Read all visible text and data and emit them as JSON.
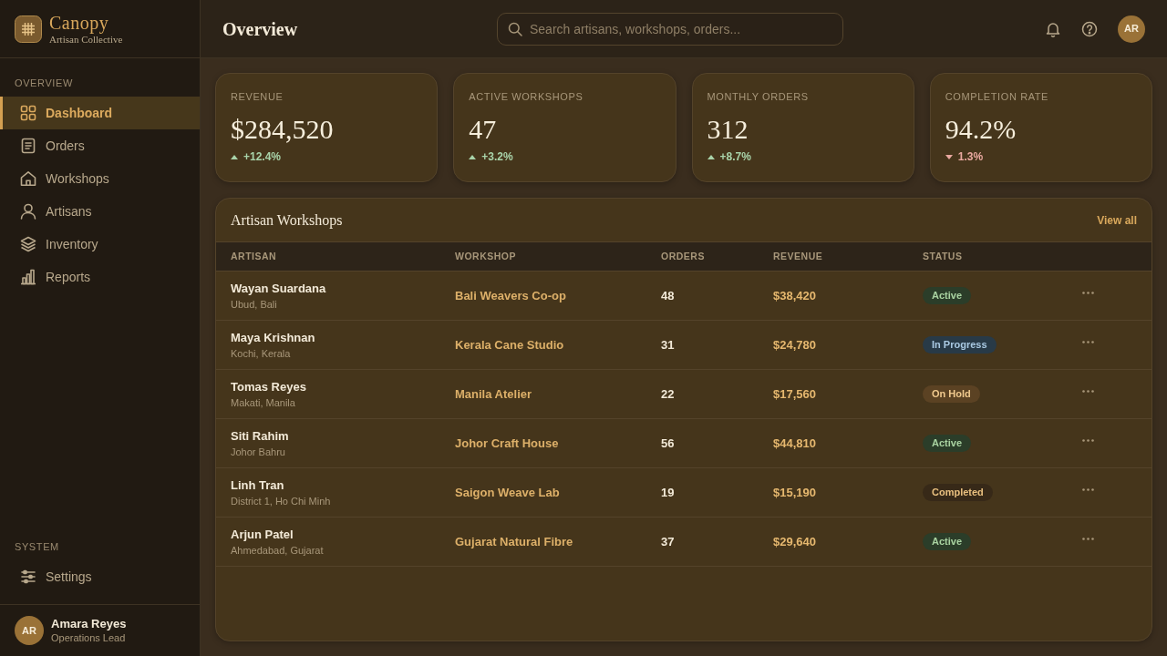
{
  "brand": {
    "name": "Canopy",
    "tagline": "Artisan Collective"
  },
  "sidebar": {
    "sections": [
      {
        "title": "OVERVIEW",
        "items": [
          {
            "label": "Dashboard",
            "selected": true
          },
          {
            "label": "Orders",
            "selected": false
          },
          {
            "label": "Workshops",
            "selected": false
          },
          {
            "label": "Artisans",
            "selected": false
          },
          {
            "label": "Inventory",
            "selected": false
          },
          {
            "label": "Reports",
            "selected": false
          }
        ]
      },
      {
        "title": "SYSTEM",
        "items": [
          {
            "label": "Settings",
            "selected": false
          }
        ]
      }
    ],
    "user": {
      "initials": "AR",
      "name": "Amara Reyes",
      "role": "Operations Lead"
    }
  },
  "header": {
    "title": "Overview",
    "search": {
      "placeholder": "Search artisans, workshops, orders..."
    },
    "avatar": {
      "initials": "AR"
    }
  },
  "stats": [
    {
      "label": "REVENUE",
      "value": "$284,520",
      "change": "+12.4%",
      "kind": "up"
    },
    {
      "label": "ACTIVE WORKSHOPS",
      "value": "47",
      "change": "+3.2%",
      "kind": "up"
    },
    {
      "label": "MONTHLY ORDERS",
      "value": "312",
      "change": "+8.7%",
      "kind": "up"
    },
    {
      "label": "COMPLETION RATE",
      "value": "94.2%",
      "change": "1.3%",
      "kind": "down"
    }
  ],
  "table": {
    "title": "Artisan Workshops",
    "action": "View all",
    "columns": [
      "ARTISAN",
      "WORKSHOP",
      "ORDERS",
      "REVENUE",
      "STATUS"
    ],
    "rows": [
      {
        "name": "Wayan Suardana",
        "location": "Ubud, Bali",
        "workshop": "Bali Weavers Co-op",
        "orders": "48",
        "revenue": "$38,420",
        "status": {
          "label": "Active",
          "kind": "active"
        }
      },
      {
        "name": "Maya Krishnan",
        "location": "Kochi, Kerala",
        "workshop": "Kerala Cane Studio",
        "orders": "31",
        "revenue": "$24,780",
        "status": {
          "label": "In Progress",
          "kind": "progress"
        }
      },
      {
        "name": "Tomas Reyes",
        "location": "Makati, Manila",
        "workshop": "Manila Atelier",
        "orders": "22",
        "revenue": "$17,560",
        "status": {
          "label": "On Hold",
          "kind": "hold"
        }
      },
      {
        "name": "Siti Rahim",
        "location": "Johor Bahru",
        "workshop": "Johor Craft House",
        "orders": "56",
        "revenue": "$44,810",
        "status": {
          "label": "Active",
          "kind": "active"
        }
      },
      {
        "name": "Linh Tran",
        "location": "District 1, Ho Chi Minh",
        "workshop": "Saigon Weave Lab",
        "orders": "19",
        "revenue": "$15,190",
        "status": {
          "label": "Completed",
          "kind": "completed"
        }
      },
      {
        "name": "Arjun Patel",
        "location": "Ahmedabad, Gujarat",
        "workshop": "Gujarat Natural Fibre",
        "orders": "37",
        "revenue": "$29,640",
        "status": {
          "label": "Active",
          "kind": "active"
        }
      }
    ]
  }
}
